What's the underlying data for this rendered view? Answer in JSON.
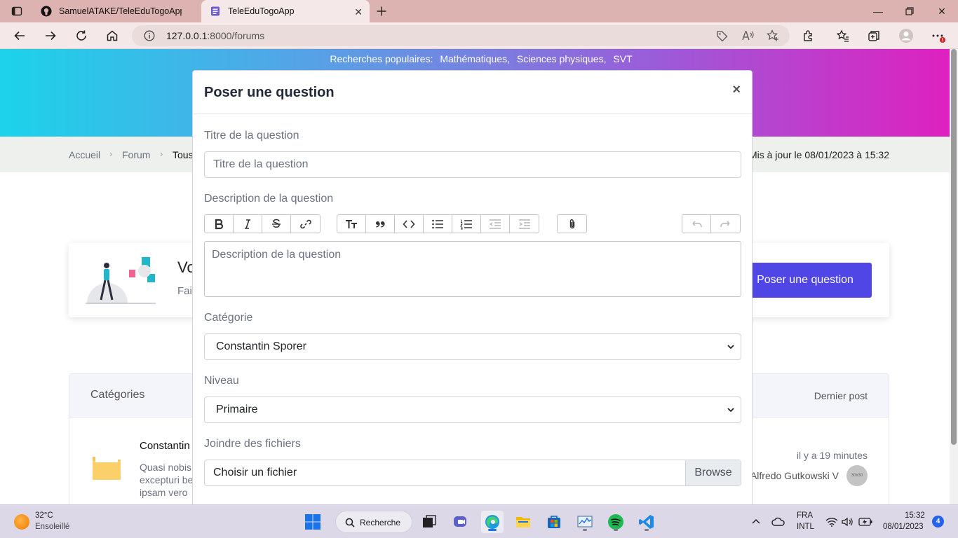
{
  "browser": {
    "tabs": [
      {
        "title": "SamuelATAKE/TeleEduTogoApp: I",
        "active": false
      },
      {
        "title": "TeleEduTogoApp",
        "active": true
      }
    ],
    "url_host": "127.0.0.1",
    "url_rest": ":8000/forums"
  },
  "page": {
    "popular_label": "Recherches populaires:",
    "popular_items": [
      "Mathématiques,",
      "Sciences physiques,",
      "SVT"
    ],
    "breadcrumb": [
      "Accueil",
      "Forum",
      "Tous"
    ],
    "updated": "Mis à jour le 08/01/2023 à 15:32",
    "card_heading": "Vo",
    "card_sub": "Fai",
    "ask_button": "Poser une question",
    "table": {
      "col_categories": "Catégories",
      "col_last_post": "Dernier post",
      "row": {
        "name": "Constantin",
        "desc_lines": [
          "Quasi nobis",
          "excepturi be",
          "ipsam vero"
        ],
        "time": "il y a 19 minutes",
        "user": "Alfredo Gutkowski V",
        "avatar_text": "30x30"
      }
    }
  },
  "modal": {
    "title": "Poser une question",
    "close": "×",
    "title_label": "Titre de la question",
    "title_placeholder": "Titre de la question",
    "desc_label": "Description de la question",
    "desc_placeholder": "Description de la question",
    "category_label": "Catégorie",
    "category_value": "Constantin Sporer",
    "level_label": "Niveau",
    "level_value": "Primaire",
    "files_label": "Joindre des fichiers",
    "file_placeholder": "Choisir un fichier",
    "browse": "Browse"
  },
  "taskbar": {
    "temp": "32°C",
    "weather": "Ensoleillé",
    "search": "Recherche",
    "lang1": "FRA",
    "lang2": "INTL",
    "time": "15:32",
    "date": "08/01/2023",
    "notifications": "4"
  },
  "colors": {
    "accent": "#4f46e5",
    "hero_start": "#1cd3ea",
    "hero_end": "#e01fbe"
  }
}
